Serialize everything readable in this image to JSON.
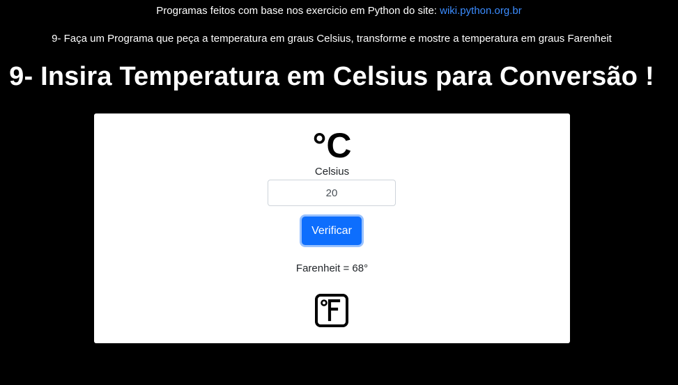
{
  "header": {
    "intro_text": "Programas feitos com base nos exercicio em Python do site: ",
    "site_link": "wiki.python.org.br",
    "exercise_description": "9- Faça um Programa que peça a temperatura em graus Celsius, transforme e mostre a temperatura em graus Farenheit"
  },
  "main": {
    "heading": "9- Insira Temperatura em Celsius para Conversão !"
  },
  "card": {
    "celsius_icon": "celsius-icon",
    "celsius_icon_text": "°C",
    "celsius_label": "Celsius",
    "celsius_value": "20",
    "verify_button": "Verificar",
    "result_text": "Farenheit = 68°",
    "fahrenheit_icon": "fahrenheit-icon"
  },
  "colors": {
    "background": "#000000",
    "link": "#3b8cff",
    "button": "#0d6efd",
    "card": "#ffffff"
  }
}
